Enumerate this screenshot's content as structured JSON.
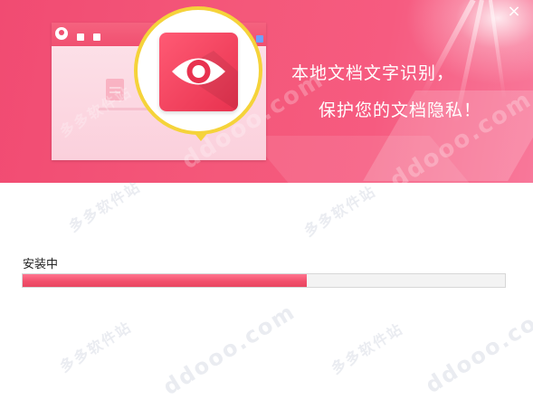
{
  "window": {
    "close_icon": "×"
  },
  "banner": {
    "slogan_line1": "本地文档文字识别，",
    "slogan_line2": "保护您的文档隐私！",
    "feature_icon": "eye-icon",
    "mock_app": {
      "title": ""
    }
  },
  "install": {
    "status_label": "安装中",
    "progress_fraction": 0.59
  },
  "watermark": {
    "site": "ddooo.com",
    "name": "多多软件站"
  },
  "colors": {
    "banner": "#f4587a",
    "accent": "#f2506c",
    "highlight_ring": "#f5d33a",
    "progress_track": "#f3f3f3"
  }
}
